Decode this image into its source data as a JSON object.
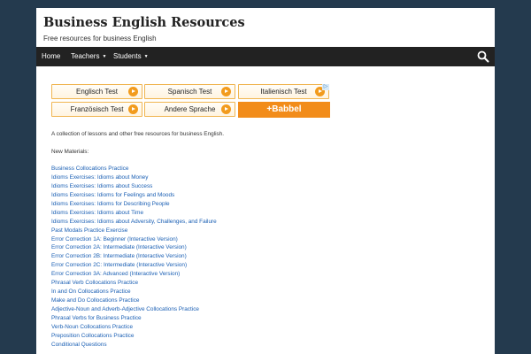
{
  "site": {
    "title": "Business English Resources",
    "description": "Free resources for business English"
  },
  "nav": {
    "items": [
      {
        "label": "Home"
      },
      {
        "label": "Teachers"
      },
      {
        "label": "Students"
      }
    ]
  },
  "ad": {
    "buttons": [
      {
        "label": "Englisch Test"
      },
      {
        "label": "Spanisch Test"
      },
      {
        "label": "Italienisch Test"
      },
      {
        "label": "Französisch Test"
      },
      {
        "label": "Andere Sprache"
      }
    ],
    "brand": "+Babbel",
    "brand_color": "#f28c1a"
  },
  "content": {
    "intro": "A collection of lessons and other free resources for business English.",
    "new_materials": "New Materials:",
    "links": [
      "Business Collocations Practice",
      "Idioms Exercises:  Idioms about Money",
      "Idioms Exercises:  Idioms about Success",
      "Idioms Exercises:  Idioms for Feelings and Moods",
      "Idioms Exercises: Idioms for Describing People",
      "Idioms Exercises: Idioms about Time",
      "Idioms Exercises: Idioms about Adversity, Challenges, and Failure",
      "Past Modals Practice Exercise",
      "Error Correction 1A: Beginner (Interactive Version)",
      "Error Correction 2A: Intermediate (Interactive Version)",
      "Error Correction 2B: Intermediate (Interactive Version)",
      "Error Correction 2C: Intermediate (Interactive Version)",
      "Error Correction 3A: Advanced (Interactive Version)",
      "Phrasal Verb Collocations Practice",
      "In and On Collocations Practice",
      "Make and Do Collocations Practice",
      "Adjective-Noun and Adverb-Adjective Collocations Practice",
      "Phrasal Verbs for Business Practice",
      "Verb-Noun Collocations Practice",
      "Preposition Collocations Practice",
      "Conditional Questions"
    ]
  },
  "colors": {
    "background": "#243a4e",
    "nav": "#222222",
    "link": "#1a5fb4"
  }
}
